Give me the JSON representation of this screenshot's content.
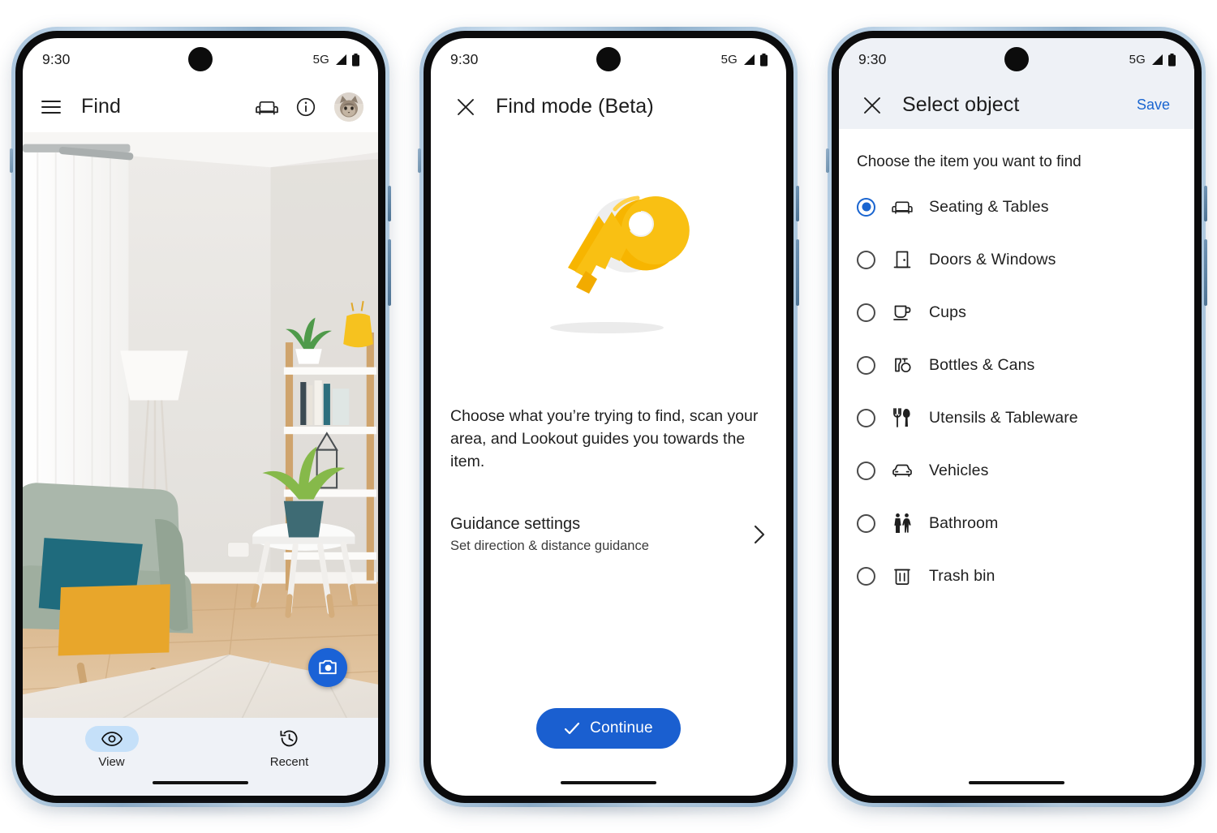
{
  "status_bar": {
    "time": "9:30",
    "network": "5G",
    "signal_icon": "signal-bars-icon",
    "battery_icon": "battery-full-icon"
  },
  "phone1": {
    "app_bar": {
      "menu_icon": "hamburger-menu-icon",
      "title": "Find",
      "sofa_icon": "sofa-icon",
      "info_icon": "info-circle-icon",
      "avatar_icon": "cat-avatar"
    },
    "viewfinder": {
      "camera_icon": "camera-icon",
      "description": "Living room camera preview"
    },
    "bottom_nav": [
      {
        "label": "View",
        "icon": "eye-icon",
        "active": true
      },
      {
        "label": "Recent",
        "icon": "history-icon",
        "active": false
      }
    ]
  },
  "phone2": {
    "top_bar": {
      "close_icon": "close-x-icon",
      "title": "Find mode (Beta)"
    },
    "hero": {
      "icon": "keys-illustration"
    },
    "description": "Choose what you’re trying to find, scan your area, and Lookout guides you towards the item.",
    "settings_row": {
      "title": "Guidance settings",
      "subtitle": "Set direction & distance guidance",
      "chevron_icon": "chevron-right-icon"
    },
    "cta": {
      "label": "Continue",
      "icon": "check-icon",
      "color": "#1a5fd0"
    }
  },
  "phone3": {
    "top_bar": {
      "close_icon": "close-x-icon",
      "title": "Select object",
      "save_label": "Save",
      "save_color": "#1a65d0"
    },
    "instruction": "Choose the item you want to find",
    "options": [
      {
        "label": "Seating & Tables",
        "icon": "sofa-icon",
        "selected": true
      },
      {
        "label": "Doors & Windows",
        "icon": "door-icon",
        "selected": false
      },
      {
        "label": "Cups",
        "icon": "cup-icon",
        "selected": false
      },
      {
        "label": "Bottles & Cans",
        "icon": "bottle-can-icon",
        "selected": false
      },
      {
        "label": "Utensils & Tableware",
        "icon": "utensils-icon",
        "selected": false
      },
      {
        "label": "Vehicles",
        "icon": "car-icon",
        "selected": false
      },
      {
        "label": "Bathroom",
        "icon": "restroom-icon",
        "selected": false
      },
      {
        "label": "Trash bin",
        "icon": "trash-icon",
        "selected": false
      }
    ]
  }
}
